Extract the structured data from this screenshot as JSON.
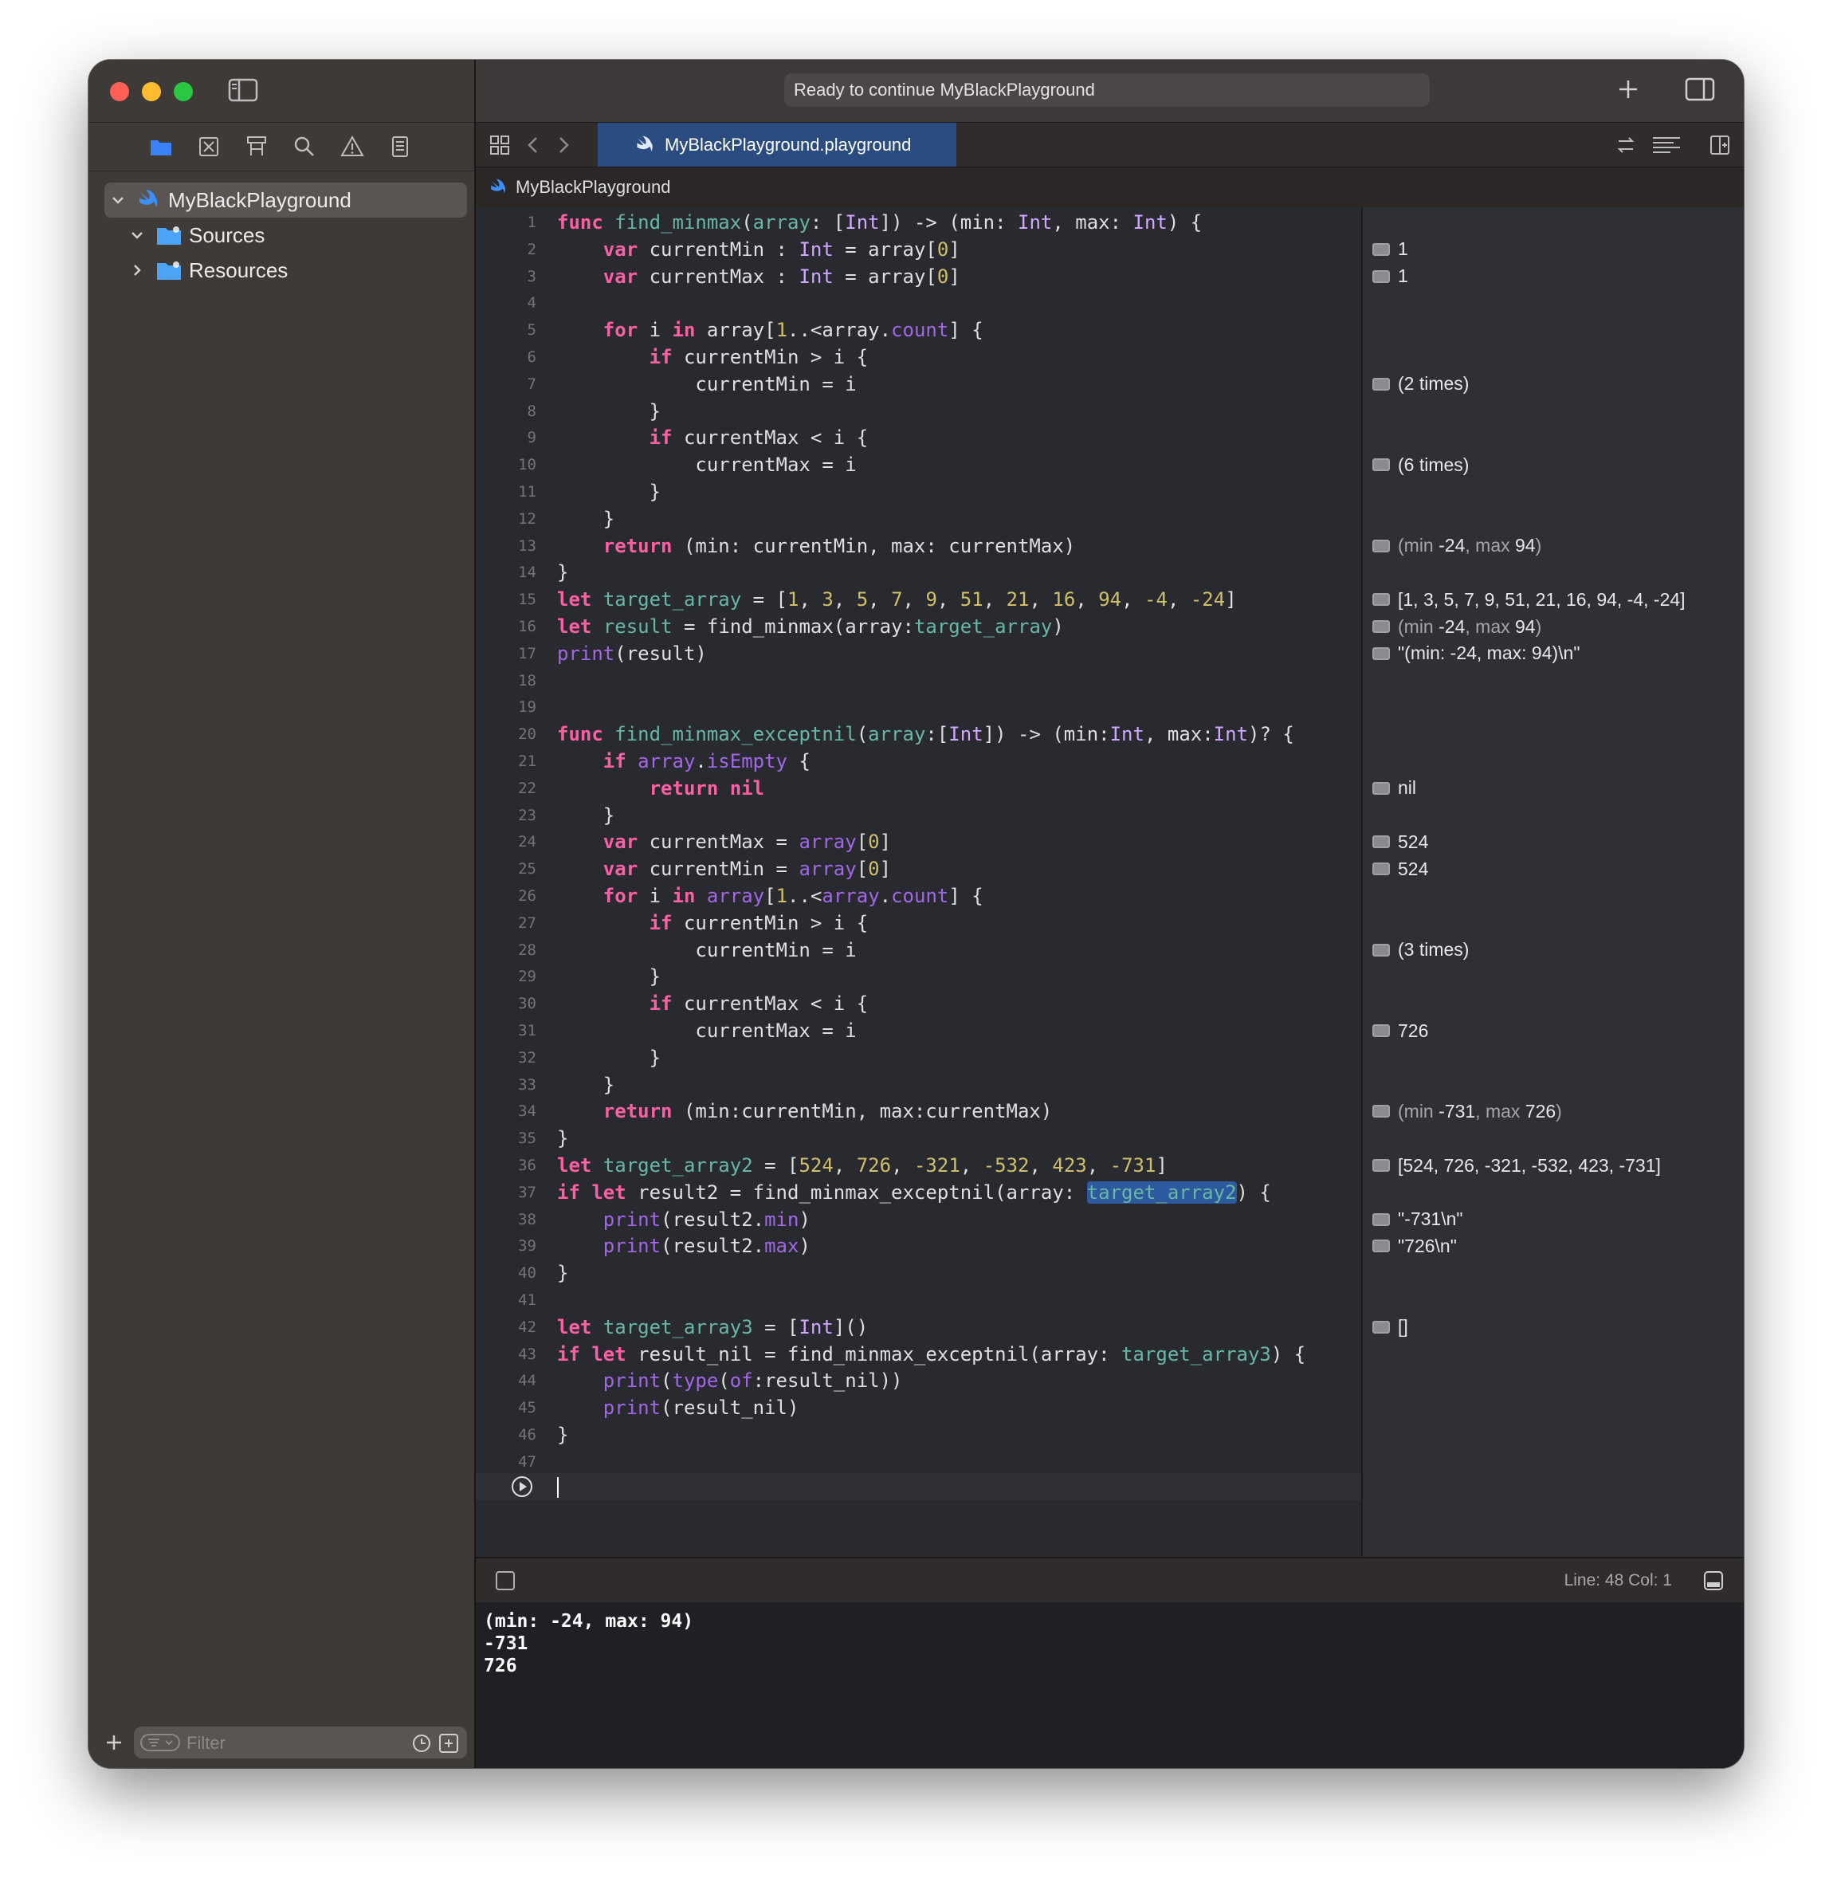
{
  "window": {
    "status": "Ready to continue MyBlackPlayground"
  },
  "sidebar": {
    "project": "MyBlackPlayground",
    "items": [
      {
        "label": "Sources"
      },
      {
        "label": "Resources"
      }
    ],
    "filter_placeholder": "Filter"
  },
  "tab": {
    "label": "MyBlackPlayground.playground"
  },
  "breadcrumb": {
    "label": "MyBlackPlayground"
  },
  "editor": {
    "lines": [
      {
        "n": "1",
        "t": [
          [
            "kw",
            "func"
          ],
          [
            "p",
            " "
          ],
          [
            "fn",
            "find_minmax"
          ],
          [
            "p",
            "("
          ],
          [
            "fn",
            "array"
          ],
          [
            "p",
            ": ["
          ],
          [
            "ty",
            "Int"
          ],
          [
            "p",
            "]) -> (min: "
          ],
          [
            "ty",
            "Int"
          ],
          [
            "p",
            ", max: "
          ],
          [
            "ty",
            "Int"
          ],
          [
            "p",
            ") {"
          ]
        ]
      },
      {
        "n": "2",
        "t": [
          [
            "p",
            "    "
          ],
          [
            "kw",
            "var"
          ],
          [
            "p",
            " currentMin : "
          ],
          [
            "ty",
            "Int"
          ],
          [
            "p",
            " = array["
          ],
          [
            "num",
            "0"
          ],
          [
            "p",
            "]"
          ]
        ]
      },
      {
        "n": "3",
        "t": [
          [
            "p",
            "    "
          ],
          [
            "kw",
            "var"
          ],
          [
            "p",
            " currentMax : "
          ],
          [
            "ty",
            "Int"
          ],
          [
            "p",
            " = array["
          ],
          [
            "num",
            "0"
          ],
          [
            "p",
            "]"
          ]
        ]
      },
      {
        "n": "4",
        "t": []
      },
      {
        "n": "5",
        "t": [
          [
            "p",
            "    "
          ],
          [
            "kw",
            "for"
          ],
          [
            "p",
            " i "
          ],
          [
            "kw",
            "in"
          ],
          [
            "p",
            " array["
          ],
          [
            "num",
            "1"
          ],
          [
            "p",
            "..<array."
          ],
          [
            "prop",
            "count"
          ],
          [
            "p",
            "] {"
          ]
        ]
      },
      {
        "n": "6",
        "t": [
          [
            "p",
            "        "
          ],
          [
            "kw",
            "if"
          ],
          [
            "p",
            " currentMin > i {"
          ]
        ]
      },
      {
        "n": "7",
        "t": [
          [
            "p",
            "            currentMin = i"
          ]
        ]
      },
      {
        "n": "8",
        "t": [
          [
            "p",
            "        }"
          ]
        ]
      },
      {
        "n": "9",
        "t": [
          [
            "p",
            "        "
          ],
          [
            "kw",
            "if"
          ],
          [
            "p",
            " currentMax < i {"
          ]
        ]
      },
      {
        "n": "10",
        "t": [
          [
            "p",
            "            currentMax = i"
          ]
        ]
      },
      {
        "n": "11",
        "t": [
          [
            "p",
            "        }"
          ]
        ]
      },
      {
        "n": "12",
        "t": [
          [
            "p",
            "    }"
          ]
        ]
      },
      {
        "n": "13",
        "t": [
          [
            "p",
            "    "
          ],
          [
            "kw",
            "return"
          ],
          [
            "p",
            " (min: currentMin, max: currentMax)"
          ]
        ]
      },
      {
        "n": "14",
        "t": [
          [
            "p",
            "}"
          ]
        ]
      },
      {
        "n": "15",
        "t": [
          [
            "kw",
            "let"
          ],
          [
            "p",
            " "
          ],
          [
            "fn",
            "target_array"
          ],
          [
            "p",
            " = ["
          ],
          [
            "num",
            "1"
          ],
          [
            "p",
            ", "
          ],
          [
            "num",
            "3"
          ],
          [
            "p",
            ", "
          ],
          [
            "num",
            "5"
          ],
          [
            "p",
            ", "
          ],
          [
            "num",
            "7"
          ],
          [
            "p",
            ", "
          ],
          [
            "num",
            "9"
          ],
          [
            "p",
            ", "
          ],
          [
            "num",
            "51"
          ],
          [
            "p",
            ", "
          ],
          [
            "num",
            "21"
          ],
          [
            "p",
            ", "
          ],
          [
            "num",
            "16"
          ],
          [
            "p",
            ", "
          ],
          [
            "num",
            "94"
          ],
          [
            "p",
            ", "
          ],
          [
            "num",
            "-4"
          ],
          [
            "p",
            ", "
          ],
          [
            "num",
            "-24"
          ],
          [
            "p",
            "]"
          ]
        ]
      },
      {
        "n": "16",
        "t": [
          [
            "kw",
            "let"
          ],
          [
            "p",
            " "
          ],
          [
            "fn",
            "result"
          ],
          [
            "p",
            " = find_minmax(array:"
          ],
          [
            "var2",
            "target_array"
          ],
          [
            "p",
            ")"
          ]
        ]
      },
      {
        "n": "17",
        "t": [
          [
            "call",
            "print"
          ],
          [
            "p",
            "(result)"
          ]
        ]
      },
      {
        "n": "18",
        "t": []
      },
      {
        "n": "19",
        "t": []
      },
      {
        "n": "20",
        "t": [
          [
            "kw",
            "func"
          ],
          [
            "p",
            " "
          ],
          [
            "fn",
            "find_minmax_exceptnil"
          ],
          [
            "p",
            "("
          ],
          [
            "fn",
            "array"
          ],
          [
            "p",
            ":["
          ],
          [
            "ty",
            "Int"
          ],
          [
            "p",
            "]) -> (min:"
          ],
          [
            "ty",
            "Int"
          ],
          [
            "p",
            ", max:"
          ],
          [
            "ty",
            "Int"
          ],
          [
            "p",
            ")? {"
          ]
        ]
      },
      {
        "n": "21",
        "t": [
          [
            "p",
            "    "
          ],
          [
            "kw",
            "if"
          ],
          [
            "p",
            " "
          ],
          [
            "prop",
            "array"
          ],
          [
            "p",
            "."
          ],
          [
            "prop",
            "isEmpty"
          ],
          [
            "p",
            " {"
          ]
        ]
      },
      {
        "n": "22",
        "t": [
          [
            "p",
            "        "
          ],
          [
            "kw",
            "return nil"
          ]
        ]
      },
      {
        "n": "23",
        "t": [
          [
            "p",
            "    }"
          ]
        ]
      },
      {
        "n": "24",
        "t": [
          [
            "p",
            "    "
          ],
          [
            "kw",
            "var"
          ],
          [
            "p",
            " currentMax = "
          ],
          [
            "prop",
            "array"
          ],
          [
            "p",
            "["
          ],
          [
            "num",
            "0"
          ],
          [
            "p",
            "]"
          ]
        ]
      },
      {
        "n": "25",
        "t": [
          [
            "p",
            "    "
          ],
          [
            "kw",
            "var"
          ],
          [
            "p",
            " currentMin = "
          ],
          [
            "prop",
            "array"
          ],
          [
            "p",
            "["
          ],
          [
            "num",
            "0"
          ],
          [
            "p",
            "]"
          ]
        ]
      },
      {
        "n": "26",
        "t": [
          [
            "p",
            "    "
          ],
          [
            "kw",
            "for"
          ],
          [
            "p",
            " i "
          ],
          [
            "kw",
            "in"
          ],
          [
            "p",
            " "
          ],
          [
            "prop",
            "array"
          ],
          [
            "p",
            "["
          ],
          [
            "num",
            "1"
          ],
          [
            "p",
            "..<"
          ],
          [
            "prop",
            "array"
          ],
          [
            "p",
            "."
          ],
          [
            "prop",
            "count"
          ],
          [
            "p",
            "] {"
          ]
        ]
      },
      {
        "n": "27",
        "t": [
          [
            "p",
            "        "
          ],
          [
            "kw",
            "if"
          ],
          [
            "p",
            " currentMin > i {"
          ]
        ]
      },
      {
        "n": "28",
        "t": [
          [
            "p",
            "            currentMin = i"
          ]
        ]
      },
      {
        "n": "29",
        "t": [
          [
            "p",
            "        }"
          ]
        ]
      },
      {
        "n": "30",
        "t": [
          [
            "p",
            "        "
          ],
          [
            "kw",
            "if"
          ],
          [
            "p",
            " currentMax < i {"
          ]
        ]
      },
      {
        "n": "31",
        "t": [
          [
            "p",
            "            currentMax = i"
          ]
        ]
      },
      {
        "n": "32",
        "t": [
          [
            "p",
            "        }"
          ]
        ]
      },
      {
        "n": "33",
        "t": [
          [
            "p",
            "    }"
          ]
        ]
      },
      {
        "n": "34",
        "t": [
          [
            "p",
            "    "
          ],
          [
            "kw",
            "return"
          ],
          [
            "p",
            " (min:currentMin, max:currentMax)"
          ]
        ]
      },
      {
        "n": "35",
        "t": [
          [
            "p",
            "}"
          ]
        ]
      },
      {
        "n": "36",
        "t": [
          [
            "kw",
            "let"
          ],
          [
            "p",
            " "
          ],
          [
            "fn",
            "target_array2"
          ],
          [
            "p",
            " = ["
          ],
          [
            "num",
            "524"
          ],
          [
            "p",
            ", "
          ],
          [
            "num",
            "726"
          ],
          [
            "p",
            ", "
          ],
          [
            "num",
            "-321"
          ],
          [
            "p",
            ", "
          ],
          [
            "num",
            "-532"
          ],
          [
            "p",
            ", "
          ],
          [
            "num",
            "423"
          ],
          [
            "p",
            ", "
          ],
          [
            "num",
            "-731"
          ],
          [
            "p",
            "]"
          ]
        ]
      },
      {
        "n": "37",
        "t": [
          [
            "kw",
            "if let"
          ],
          [
            "p",
            " result2 = find_minmax_exceptnil(array: "
          ],
          [
            "sel",
            "target_array2"
          ],
          [
            "p",
            ") {"
          ]
        ]
      },
      {
        "n": "38",
        "t": [
          [
            "p",
            "    "
          ],
          [
            "call",
            "print"
          ],
          [
            "p",
            "(result2."
          ],
          [
            "prop",
            "min"
          ],
          [
            "p",
            ")"
          ]
        ]
      },
      {
        "n": "39",
        "t": [
          [
            "p",
            "    "
          ],
          [
            "call",
            "print"
          ],
          [
            "p",
            "(result2."
          ],
          [
            "prop",
            "max"
          ],
          [
            "p",
            ")"
          ]
        ]
      },
      {
        "n": "40",
        "t": [
          [
            "p",
            "}"
          ]
        ]
      },
      {
        "n": "41",
        "t": []
      },
      {
        "n": "42",
        "t": [
          [
            "kw",
            "let"
          ],
          [
            "p",
            " "
          ],
          [
            "fn",
            "target_array3"
          ],
          [
            "p",
            " = ["
          ],
          [
            "ty",
            "Int"
          ],
          [
            "p",
            "]()"
          ]
        ]
      },
      {
        "n": "43",
        "t": [
          [
            "kw",
            "if let"
          ],
          [
            "p",
            " result_nil = find_minmax_exceptnil(array: "
          ],
          [
            "var2",
            "target_array3"
          ],
          [
            "p",
            ") {"
          ]
        ]
      },
      {
        "n": "44",
        "t": [
          [
            "p",
            "    "
          ],
          [
            "call",
            "print"
          ],
          [
            "p",
            "("
          ],
          [
            "call",
            "type"
          ],
          [
            "p",
            "("
          ],
          [
            "call",
            "of"
          ],
          [
            "p",
            ":result_nil))"
          ]
        ]
      },
      {
        "n": "45",
        "t": [
          [
            "p",
            "    "
          ],
          [
            "call",
            "print"
          ],
          [
            "p",
            "(result_nil)"
          ]
        ]
      },
      {
        "n": "46",
        "t": [
          [
            "p",
            "}"
          ]
        ]
      },
      {
        "n": "47",
        "t": []
      }
    ]
  },
  "results": [
    {
      "line": 2,
      "text": "1"
    },
    {
      "line": 3,
      "text": "1"
    },
    {
      "line": 7,
      "text": "(2 times)"
    },
    {
      "line": 10,
      "text": "(6 times)"
    },
    {
      "line": 13,
      "parts": [
        [
          "dim",
          "(min "
        ],
        [
          "v",
          "-24"
        ],
        [
          "dim",
          ", max "
        ],
        [
          "v",
          "94"
        ],
        [
          "dim",
          ")"
        ]
      ]
    },
    {
      "line": 15,
      "text": "[1, 3, 5, 7, 9, 51, 21, 16, 94, -4, -24]"
    },
    {
      "line": 16,
      "parts": [
        [
          "dim",
          "(min "
        ],
        [
          "v",
          "-24"
        ],
        [
          "dim",
          ", max "
        ],
        [
          "v",
          "94"
        ],
        [
          "dim",
          ")"
        ]
      ]
    },
    {
      "line": 17,
      "text": "\"(min: -24, max: 94)\\n\""
    },
    {
      "line": 22,
      "text": "nil"
    },
    {
      "line": 24,
      "text": "524"
    },
    {
      "line": 25,
      "text": "524"
    },
    {
      "line": 28,
      "text": "(3 times)"
    },
    {
      "line": 31,
      "text": "726"
    },
    {
      "line": 34,
      "parts": [
        [
          "dim",
          "(min "
        ],
        [
          "v",
          "-731"
        ],
        [
          "dim",
          ", max "
        ],
        [
          "v",
          "726"
        ],
        [
          "dim",
          ")"
        ]
      ]
    },
    {
      "line": 36,
      "text": "[524, 726, -321, -532, 423, -731]"
    },
    {
      "line": 38,
      "text": "\"-731\\n\""
    },
    {
      "line": 39,
      "text": "\"726\\n\""
    },
    {
      "line": 42,
      "text": "[]"
    }
  ],
  "debug": {
    "line_col": "Line: 48  Col: 1",
    "console_output": "(min: -24, max: 94)\n-731\n726"
  }
}
